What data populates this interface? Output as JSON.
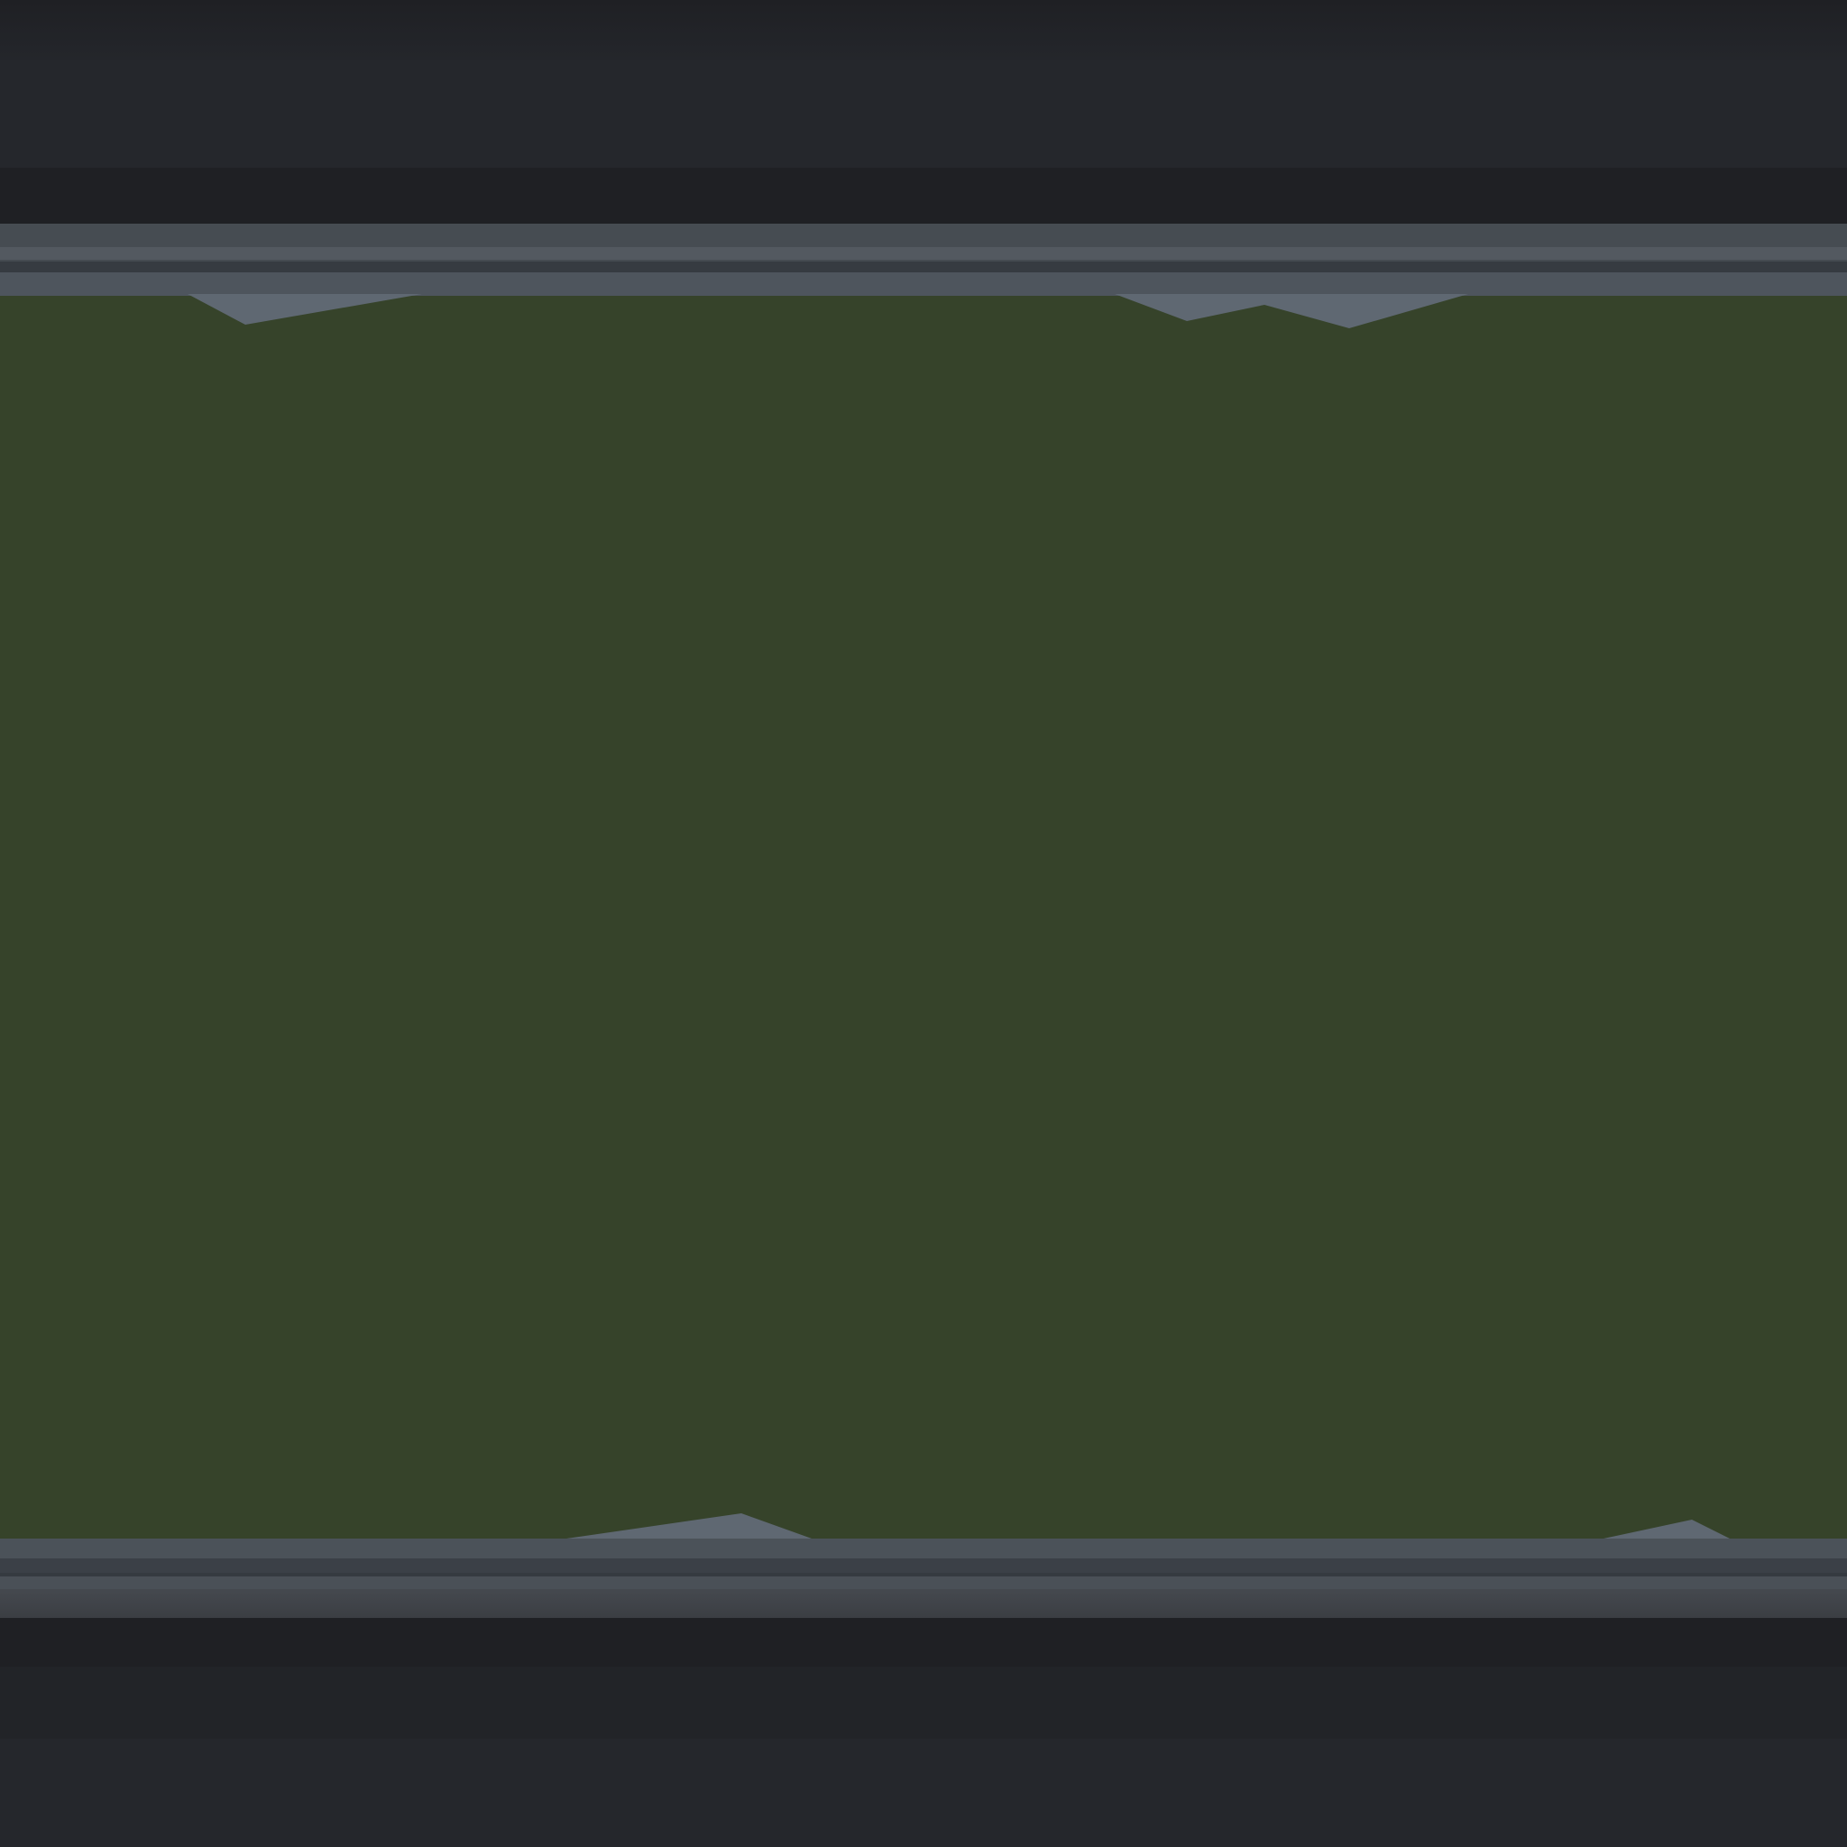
{
  "scene": {
    "colors": {
      "background": "#25272c",
      "field": "#36432a",
      "rail": "#4e555d",
      "spike": "#5f6872"
    }
  }
}
